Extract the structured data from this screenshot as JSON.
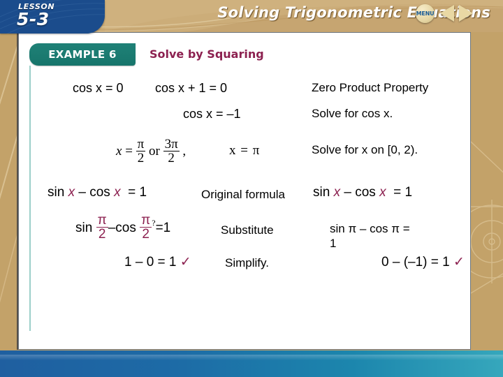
{
  "header": {
    "title": "Solving Trigonometric Equations",
    "lesson_word": "LESSON",
    "lesson_number": "5-3"
  },
  "example": {
    "tab_label": "EXAMPLE 6",
    "title": "Solve by Squaring"
  },
  "solution": {
    "line1": {
      "left_eq": "cos x = 0",
      "right_eq": "cos x + 1 = 0",
      "reason": "Zero Product Property"
    },
    "line2": {
      "equation": "cos x = –1",
      "reason": "Solve for cos x."
    },
    "line3": {
      "lhs_var": "x",
      "equals": "=",
      "frac1_num": "π",
      "frac1_den": "2",
      "or_word": "or",
      "frac2_num": "3π",
      "frac2_den": "2",
      "comma": ",",
      "second_solution": "x = π",
      "reason": "Solve for x on [0, 2)."
    }
  },
  "check_labels": {
    "original_formula": "Original formula",
    "substitute": "Substitute",
    "simplify": "Simplify."
  },
  "check_left": {
    "row1": {
      "sin": "sin",
      "var1": "x",
      "minus": "–",
      "cos": "cos",
      "var2": "x",
      "equals": "=",
      "rhs": "1"
    },
    "row2": {
      "sin": "sin",
      "frac1_num": "π",
      "frac1_den": "2",
      "minus": "–",
      "cos": "cos",
      "frac2_num": "π",
      "frac2_den": "2",
      "question": "?",
      "equals": "=",
      "rhs": "1"
    },
    "row3": {
      "expression": "1 – 0 = 1",
      "check_mark": "✓"
    }
  },
  "check_right": {
    "row1": {
      "sin": "sin",
      "var1": "x",
      "minus": "–",
      "cos": "cos",
      "var2": "x",
      "equals": "=",
      "rhs": "1"
    },
    "row2": {
      "line_a": "sin π – cos π =",
      "question": "?",
      "line_b": "1"
    },
    "row3": {
      "expression": "0 – (–1) = 1",
      "check_mark": "✓"
    }
  },
  "navigation": {
    "menu_label": "MENU",
    "prev_label": "◀",
    "next_label": "▶"
  },
  "colors": {
    "banner_tan": "#c6a571",
    "lesson_blue": "#1b4c8c",
    "example_teal": "#17756b",
    "title_maroon": "#8c2150",
    "bottom_bar_blue": "#1f5fa0",
    "bottom_bar_cyan": "#36a7bc"
  }
}
